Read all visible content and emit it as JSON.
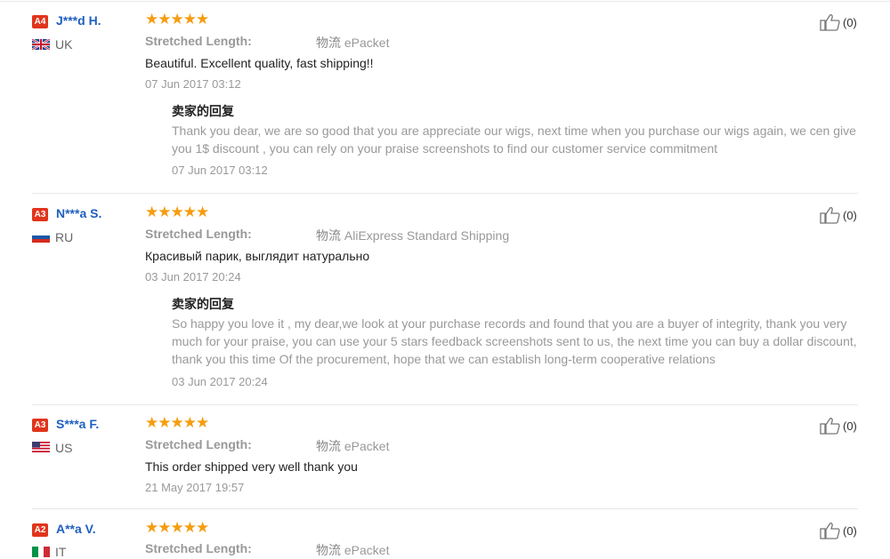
{
  "reviews": [
    {
      "level": "A4",
      "name": "J***d H.",
      "country": "UK",
      "flag": "uk",
      "stars": "★★★★★",
      "attr_label": "Stretched Length:",
      "ship_prefix": "物流",
      "ship_method": "ePacket",
      "comment": "Beautiful. Excellent quality, fast shipping!!",
      "date": "07 Jun 2017 03:12",
      "reply_title": "卖家的回复",
      "reply_lines": [
        "Thank you dear, we are so good that you are appreciate our wigs, next time when you purchase our wigs again, we cen give",
        "you 1$ discount , you can rely on your praise screenshots to find our customer service commitment"
      ],
      "reply_date": "07 Jun 2017 03:12",
      "helpful": "(0)"
    },
    {
      "level": "A3",
      "name": "N***a S.",
      "country": "RU",
      "flag": "ru",
      "stars": "★★★★★",
      "attr_label": "Stretched Length:",
      "ship_prefix": "物流",
      "ship_method": "AliExpress Standard Shipping",
      "comment": "Красивый парик, выглядит натурально",
      "date": "03 Jun 2017 20:24",
      "reply_title": "卖家的回复",
      "reply_lines": [
        "So happy you love it , my dear,we look at your purchase records and found that you are a buyer of integrity, thank you very",
        "much for your praise, you can use your 5 stars feedback screenshots sent to us, the next time you can buy a dollar discount,",
        "thank you this time Of the procurement, hope that we can establish long-term cooperative relations"
      ],
      "reply_date": "03 Jun 2017 20:24",
      "helpful": "(0)"
    },
    {
      "level": "A3",
      "name": "S***a F.",
      "country": "US",
      "flag": "us",
      "stars": "★★★★★",
      "attr_label": "Stretched Length:",
      "ship_prefix": "物流",
      "ship_method": "ePacket",
      "comment": "This order shipped very well thank you",
      "date": "21 May 2017 19:57",
      "helpful": "(0)"
    },
    {
      "level": "A2",
      "name": "A**a V.",
      "country": "IT",
      "flag": "it",
      "stars": "★★★★★",
      "attr_label": "Stretched Length:",
      "ship_prefix": "物流",
      "ship_method": "ePacket",
      "helpful": "(0)"
    }
  ],
  "colors": {
    "badge": "#e1351c",
    "name": "#1f5fbf",
    "star": "#f59d10"
  }
}
